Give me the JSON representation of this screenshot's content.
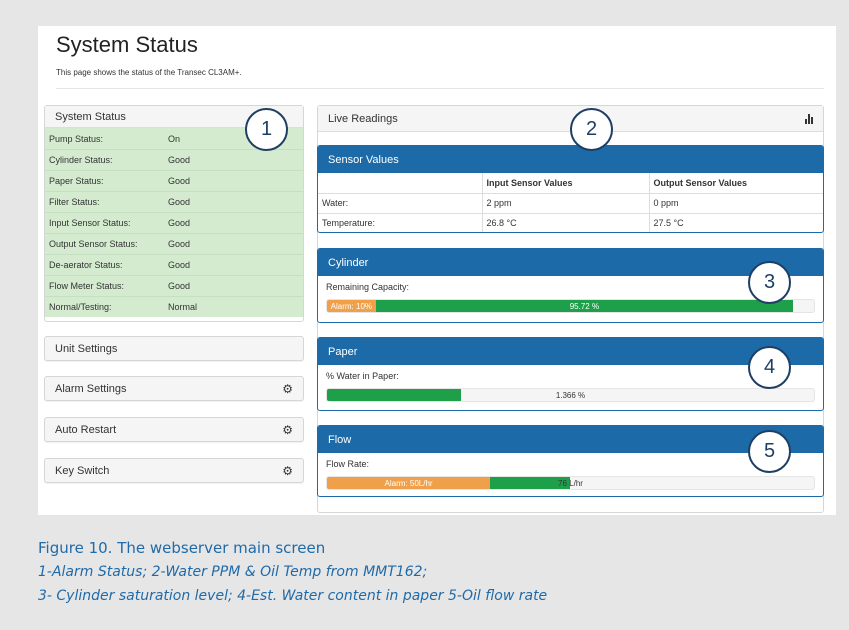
{
  "page": {
    "title": "System Status",
    "description": "This page shows the status of the Transec CL3AM+."
  },
  "system_status": {
    "heading": "System Status",
    "rows": [
      {
        "label": "Pump Status:",
        "value": "On"
      },
      {
        "label": "Cylinder Status:",
        "value": "Good"
      },
      {
        "label": "Paper Status:",
        "value": "Good"
      },
      {
        "label": "Filter Status:",
        "value": "Good"
      },
      {
        "label": "Input Sensor Status:",
        "value": "Good"
      },
      {
        "label": "Output Sensor Status:",
        "value": "Good"
      },
      {
        "label": "De-aerator Status:",
        "value": "Good"
      },
      {
        "label": "Flow Meter Status:",
        "value": "Good"
      },
      {
        "label": "Normal/Testing:",
        "value": "Normal"
      }
    ]
  },
  "settings": {
    "unit": "Unit Settings",
    "alarm": "Alarm Settings",
    "auto_restart": "Auto Restart",
    "key_switch": "Key Switch"
  },
  "live": {
    "heading": "Live Readings",
    "icon": "bar-chart-icon"
  },
  "sensor_values": {
    "heading": "Sensor Values",
    "columns": [
      "",
      "Input Sensor Values",
      "Output Sensor Values"
    ],
    "rows": [
      {
        "label": "Water:",
        "input": "2 ppm",
        "output": "0 ppm"
      },
      {
        "label": "Temperature:",
        "input": "26.8 °C",
        "output": "27.5 °C"
      }
    ]
  },
  "cylinder": {
    "heading": "Cylinder",
    "label": "Remaining Capacity:",
    "alarm_label": "Alarm: 10%",
    "alarm_fraction": 0.1,
    "value_label": "95.72 %",
    "value_fraction": 0.9572
  },
  "paper": {
    "heading": "Paper",
    "label": "% Water in Paper:",
    "value_label": "1.366 %",
    "fill_fraction": 0.275
  },
  "flow": {
    "heading": "Flow",
    "label": "Flow Rate:",
    "alarm_label": "Alarm: 50L/hr",
    "alarm_fraction": 0.335,
    "value_label": "76 L/hr",
    "value_fraction": 0.5
  },
  "callouts": [
    "1",
    "2",
    "3",
    "4",
    "5"
  ],
  "caption": {
    "title": "Figure 10. The webserver main screen",
    "line1": "1-Alarm Status; 2-Water PPM & Oil Temp from MMT162;",
    "line2": "3- Cylinder saturation level; 4-Est. Water content in paper 5-Oil flow rate"
  },
  "colors": {
    "accent": "#1c6aa8",
    "ok_green_bg": "#d4ebd0",
    "bar_green": "#1ea04a",
    "bar_orange": "#f0a04b",
    "caption": "#1f6aa8"
  }
}
